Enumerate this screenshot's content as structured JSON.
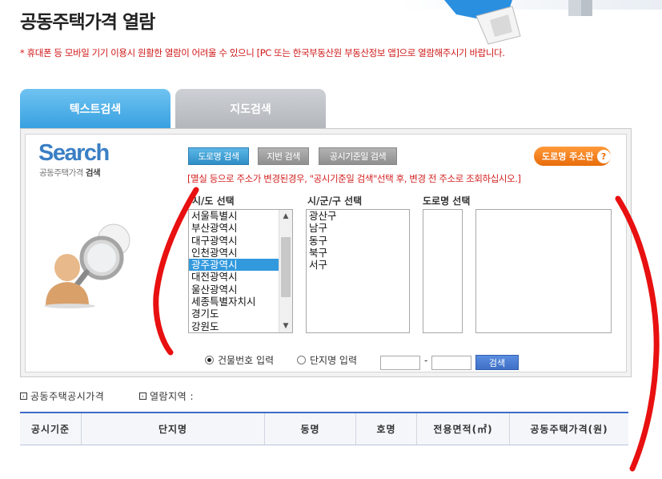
{
  "header": {
    "title": "공동주택가격 열람",
    "notice": "* 휴대폰 등 모바일 기기 이용시 원활한 열람이 어려울 수 있으니 [PC 또는 한국부동산원 부동산정보 앱]으로 열람해주시기 바랍니다."
  },
  "tabs": [
    {
      "label": "텍스트검색"
    },
    {
      "label": "지도검색"
    }
  ],
  "search_panel": {
    "logo": "Search",
    "subtitle_prefix": "공동주택가격 ",
    "subtitle_bold": "검색",
    "mode_buttons": {
      "road": "도로명 검색",
      "lot": "지번 검색",
      "date": "공시기준일 검색"
    },
    "road_help_label": "도로명 주소란",
    "road_help_icon_char": "?",
    "warning": "[멸실 등으로 주소가 변경된경우, \"공시기준일 검색\"선택 후, 변경 전 주소로 조회하십시오.]",
    "labels": {
      "city": "시/도 선택",
      "gu": "시/군/구 선택",
      "road": "도로명 선택"
    },
    "city_options": [
      "서울특별시",
      "부산광역시",
      "대구광역시",
      "인천광역시",
      "광주광역시",
      "대전광역시",
      "울산광역시",
      "세종특별자치시",
      "경기도",
      "강원도"
    ],
    "city_selected": "광주광역시",
    "gu_options": [
      "광산구",
      "남구",
      "동구",
      "북구",
      "서구"
    ],
    "radio_building": "건물번호 입력",
    "radio_complex": "단지명 입력",
    "radio_selected": "building",
    "input_dash": "-",
    "search_button": "검색"
  },
  "results": {
    "price_label": "공동주택공시가격",
    "area_label": "열람지역 :",
    "columns": [
      "공시기준",
      "단지명",
      "동명",
      "호명",
      "전용면적(㎡)",
      "공동주택가격(원)"
    ]
  },
  "colors": {
    "active_tab": "#37a0e0",
    "inactive_tab": "#b3b7bc",
    "notice_red": "#d01818",
    "help_orange": "#e86c0a",
    "selection_blue": "#3399dd",
    "annotation_red": "#e81010"
  }
}
